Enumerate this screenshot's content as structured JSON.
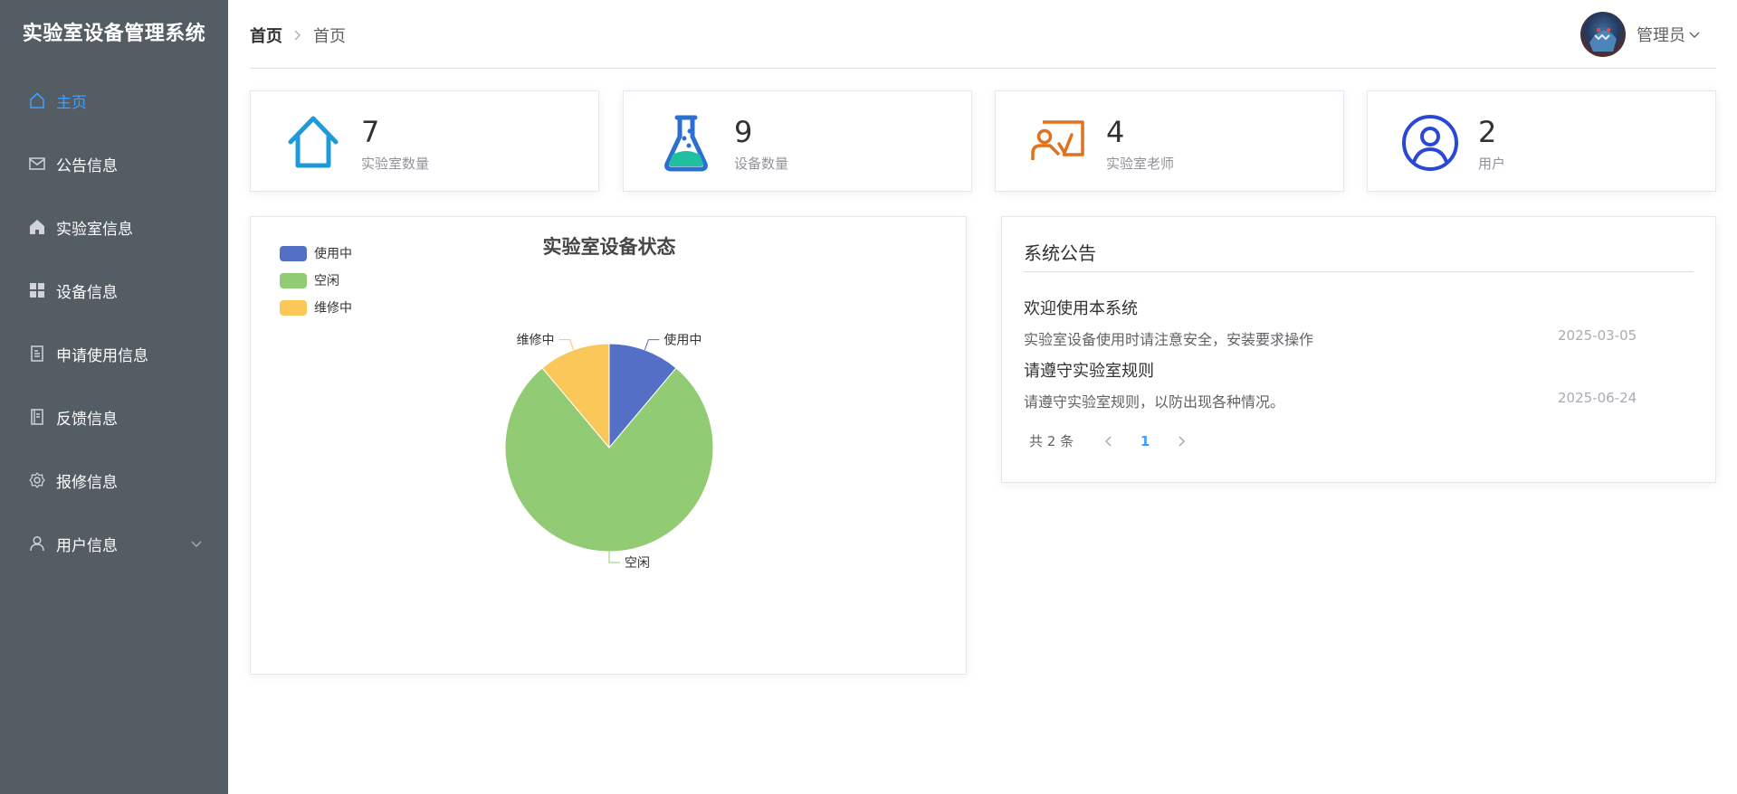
{
  "app": {
    "title": "实验室设备管理系统"
  },
  "sidebar": {
    "items": [
      {
        "label": "主页",
        "icon": "home-icon",
        "active": true
      },
      {
        "label": "公告信息",
        "icon": "mail-icon"
      },
      {
        "label": "实验室信息",
        "icon": "house-filled-icon"
      },
      {
        "label": "设备信息",
        "icon": "grid-icon"
      },
      {
        "label": "申请使用信息",
        "icon": "document-icon"
      },
      {
        "label": "反馈信息",
        "icon": "notebook-icon"
      },
      {
        "label": "报修信息",
        "icon": "gear-icon"
      },
      {
        "label": "用户信息",
        "icon": "user-icon",
        "expandable": true
      }
    ]
  },
  "header": {
    "breadcrumb": [
      "首页",
      "首页"
    ],
    "user": {
      "name": "管理员"
    }
  },
  "stats": [
    {
      "value": "7",
      "label": "实验室数量",
      "icon": "house-outline-icon",
      "color": "#1e9bd7"
    },
    {
      "value": "9",
      "label": "设备数量",
      "icon": "flask-icon",
      "color": "#2c6fd1"
    },
    {
      "value": "4",
      "label": "实验室老师",
      "icon": "teacher-icon",
      "color": "#e0711d"
    },
    {
      "value": "2",
      "label": "用户",
      "icon": "user-circle-icon",
      "color": "#2948d6"
    }
  ],
  "chart_data": {
    "type": "pie",
    "title": "实验室设备状态",
    "legend_position": "top-left",
    "categories": [
      "使用中",
      "空闲",
      "维修中"
    ],
    "values": [
      1,
      7,
      1
    ],
    "colors": [
      "#5470c6",
      "#91cc75",
      "#fac858"
    ]
  },
  "notice": {
    "title": "系统公告",
    "items": [
      {
        "title": "欢迎使用本系统",
        "content": "实验室设备使用时请注意安全，安装要求操作",
        "date": "2025-03-05"
      },
      {
        "title": "请遵守实验室规则",
        "content": "请遵守实验室规则，以防出现各种情况。",
        "date": "2025-06-24"
      }
    ],
    "pagination": {
      "total_text": "共 2 条",
      "current_page": "1"
    }
  }
}
